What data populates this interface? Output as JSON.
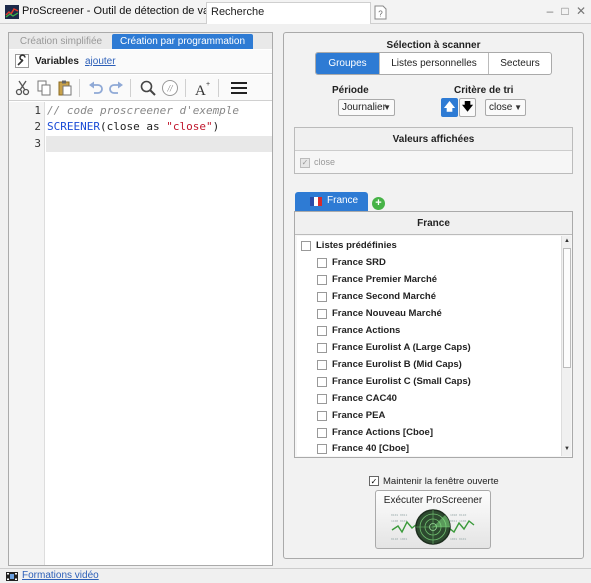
{
  "window": {
    "title": "ProScreener - Outil de détection de valeurs",
    "search_tab": "Recherche"
  },
  "left_panel": {
    "tabs": [
      "Création simplifiée",
      "Création par programmation"
    ],
    "active_tab": "Création par programmation",
    "variables_label": "Variables",
    "variables_add_link": "ajouter",
    "toolbar_icons": [
      "cut-icon",
      "copy-icon",
      "paste-icon",
      "undo-icon",
      "redo-icon",
      "search-icon",
      "comment-icon",
      "font-size-icon",
      "menu-icon"
    ],
    "code_lines": [
      {
        "number": "1",
        "parts": [
          {
            "text": "// code proscreener d'exemple",
            "kind": "comment"
          }
        ]
      },
      {
        "number": "2",
        "parts": [
          {
            "text": "SCREENER",
            "kind": "keyword"
          },
          {
            "text": "(close as ",
            "kind": "plain"
          },
          {
            "text": "\"close\"",
            "kind": "string"
          },
          {
            "text": ")",
            "kind": "plain"
          }
        ]
      },
      {
        "number": "3",
        "parts": []
      }
    ]
  },
  "right_panel": {
    "selection_title": "Sélection à scanner",
    "segments": [
      "Groupes",
      "Listes personnelles",
      "Secteurs"
    ],
    "active_segment": "Groupes",
    "period_label": "Période",
    "period_value": "Journalier",
    "sort_label": "Critère de tri",
    "sort_value": "close",
    "sort_direction": "ascending",
    "displayed_values_title": "Valeurs affichées",
    "displayed_values": [
      {
        "label": "close",
        "checked": true,
        "enabled": false
      }
    ],
    "market_tab": "France",
    "market_box_title": "France",
    "list_group": {
      "label": "Listes prédéfinies",
      "checked": false
    },
    "list_items": [
      "France SRD",
      "France Premier Marché",
      "France Second Marché",
      "France Nouveau Marché",
      "France Actions",
      "France Eurolist A (Large Caps)",
      "France Eurolist B (Mid Caps)",
      "France Eurolist C (Small Caps)",
      "France CAC40",
      "France PEA",
      "France Actions [Cboe]",
      "France 40 [Cboe]"
    ],
    "keep_open_label": "Maintenir la fenêtre ouverte",
    "keep_open_checked": true,
    "run_button_label": "Exécuter ProScreener"
  },
  "statusbar": {
    "video_link": "Formations vidéo"
  },
  "colors": {
    "accent": "#2e7bd4",
    "link": "#2c5fb8",
    "keyword": "#1a4bd6",
    "string": "#c0162c",
    "comment": "#888888"
  }
}
